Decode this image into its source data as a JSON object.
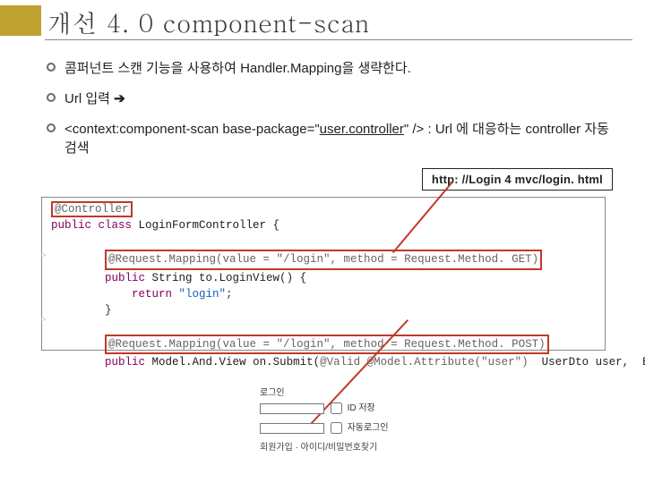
{
  "title": "개선 4. 0 component-scan",
  "bullets": {
    "b1": "콤퍼넌트 스캔 기능을 사용하여 Handler.Mapping을 생략한다.",
    "b2_prefix": "Url 입력 ",
    "b2_arrow": "➔",
    "b3_prefix": "<context:component-scan base-package=\"",
    "b3_pkg": "user.controller",
    "b3_suffix": "\" />  : Url 에 대응하는 controller 자동 검색"
  },
  "url_box": "http: //Login 4 mvc/login. html",
  "code": {
    "c1_anno": "@Controller",
    "c2_pub": "public ",
    "c2_cls": "class ",
    "c2_name": "LoginFormController {",
    "c4_rm": "@Request.Mapping(value = \"/login\", method = Request.Method. GET)",
    "c5a": "public ",
    "c5b": "String ",
    "c5c": "to.LoginView() {",
    "c6a": "return ",
    "c6b": "\"login\"",
    "c6c": ";",
    "c7": "}",
    "c9_rm": "@Request.Mapping(value = \"/login\", method = Request.Method. POST)",
    "c10a": "public ",
    "c10b": "Model.And.View ",
    "c10c": "on.Submit(",
    "c10d": "@Valid @Model.Attribute(\"user\")",
    "c10e": "  UserDto user,  Bind"
  },
  "login_form": {
    "title": "로그인",
    "save": "ID 저장",
    "auto": "자동로그인",
    "links": "회원가입 · 아이디/비밀번호찾기"
  }
}
